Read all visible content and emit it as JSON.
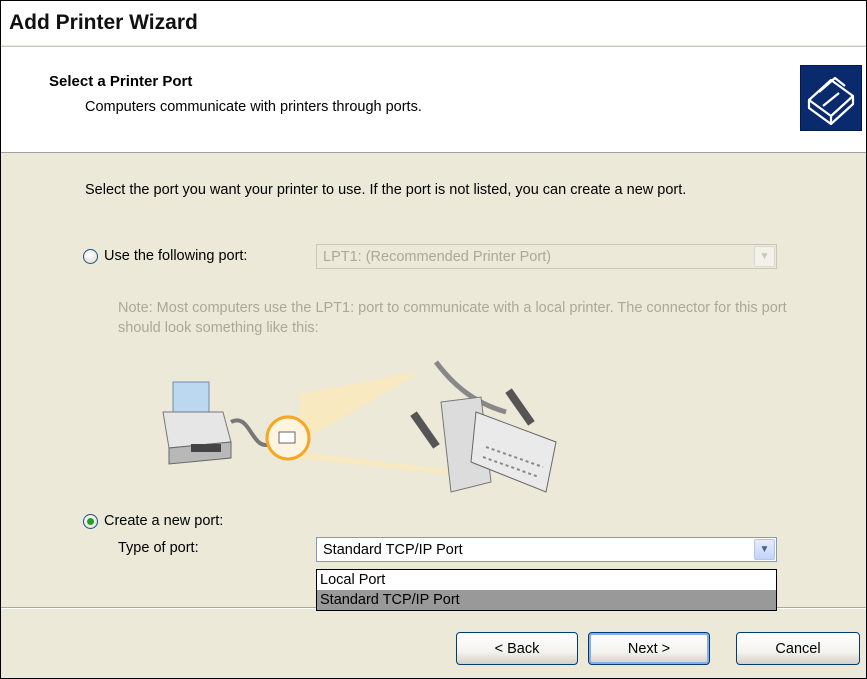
{
  "window": {
    "title": "Add Printer Wizard"
  },
  "header": {
    "title": "Select a Printer Port",
    "subtitle": "Computers communicate with printers through ports.",
    "icon": "printer-wizard-icon"
  },
  "body": {
    "intro": "Select the port you want your printer to use.  If the port is not listed, you can create a new port.",
    "use_port": {
      "label": "Use the following port:",
      "selected": false,
      "combo_value": "LPT1: (Recommended Printer Port)",
      "enabled": false
    },
    "note": "Note: Most computers use the LPT1: port to communicate with a local printer. The connector for this port should look something like this:",
    "create_port": {
      "label": "Create a new port:",
      "selected": true,
      "type_label": "Type of port:",
      "combo_value": "Standard TCP/IP Port",
      "options": [
        "Local Port",
        "Standard TCP/IP Port"
      ],
      "selected_option": "Standard TCP/IP Port"
    }
  },
  "footer": {
    "back_label": "< Back",
    "next_label": "Next >",
    "cancel_label": "Cancel"
  },
  "colors": {
    "face": "#ECE9D8",
    "radio_dot": "#21a121",
    "disabled_text": "#aca899",
    "list_highlight": "#999999",
    "button_border": "#003c74"
  }
}
